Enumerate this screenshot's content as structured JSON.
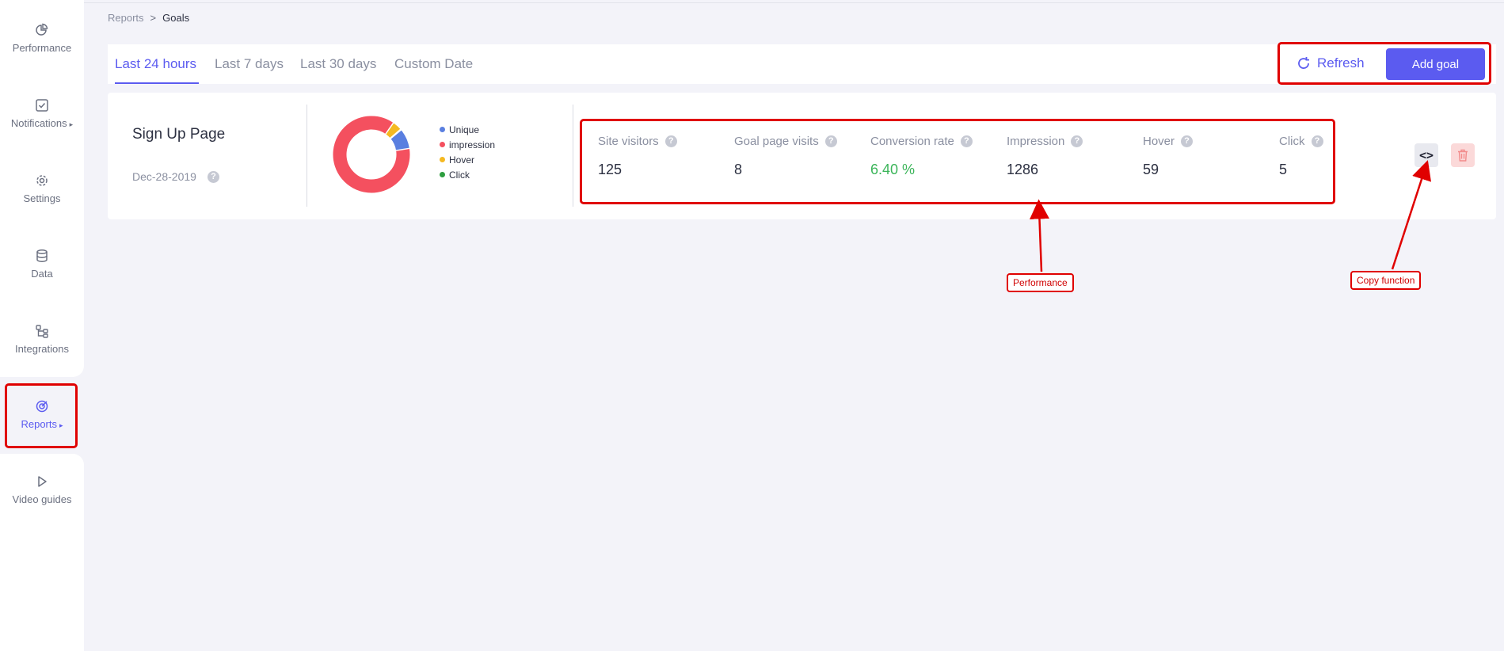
{
  "sidebar": {
    "items": [
      {
        "label": "Performance",
        "icon": "pie-chart-icon",
        "active": false
      },
      {
        "label": "Notifications",
        "icon": "checkbox-icon",
        "active": false,
        "caret": "▸"
      },
      {
        "label": "Settings",
        "icon": "gear-icon",
        "active": false
      },
      {
        "label": "Data",
        "icon": "database-icon",
        "active": false
      },
      {
        "label": "Integrations",
        "icon": "integrations-icon",
        "active": false
      },
      {
        "label": "Reports",
        "icon": "target-icon",
        "active": true,
        "caret": "▸"
      },
      {
        "label": "Video guides",
        "icon": "play-icon",
        "active": false
      }
    ]
  },
  "breadcrumb": {
    "parent": "Reports",
    "separator": ">",
    "current": "Goals"
  },
  "tabs": [
    {
      "label": "Last 24 hours",
      "active": true
    },
    {
      "label": "Last 7 days",
      "active": false
    },
    {
      "label": "Last 30 days",
      "active": false
    },
    {
      "label": "Custom Date",
      "active": false
    }
  ],
  "toolbar": {
    "refresh_label": "Refresh",
    "add_goal_label": "Add goal"
  },
  "goal": {
    "name": "Sign Up Page",
    "date": "Dec-28-2019",
    "help": "?",
    "legend": [
      {
        "label": "Unique",
        "color": "#5a7fe0"
      },
      {
        "label": "impression",
        "color": "#f4505f"
      },
      {
        "label": "Hover",
        "color": "#f5b921"
      },
      {
        "label": "Click",
        "color": "#2e9e3f"
      }
    ],
    "metrics": [
      {
        "label": "Site visitors",
        "value": "125"
      },
      {
        "label": "Goal page visits",
        "value": "8"
      },
      {
        "label": "Conversion rate",
        "value": "6.40 %"
      },
      {
        "label": "Impression",
        "value": "1286"
      },
      {
        "label": "Hover",
        "value": "59"
      },
      {
        "label": "Click",
        "value": "5"
      }
    ],
    "copy_label": "<>"
  },
  "chart_data": {
    "type": "pie",
    "categories": [
      "Unique",
      "impression",
      "Hover",
      "Click"
    ],
    "values": [
      125,
      1286,
      59,
      5
    ],
    "colors": [
      "#5a7fe0",
      "#f4505f",
      "#f5b921",
      "#2e9e3f"
    ],
    "donut": true,
    "legend": "right"
  },
  "annotations": {
    "performance_label": "Performance",
    "copy_label": "Copy function"
  },
  "colors": {
    "accent": "#5b5bf0",
    "positive": "#3cb55a",
    "annotation": "#e00000",
    "danger": "#f28b8b"
  }
}
